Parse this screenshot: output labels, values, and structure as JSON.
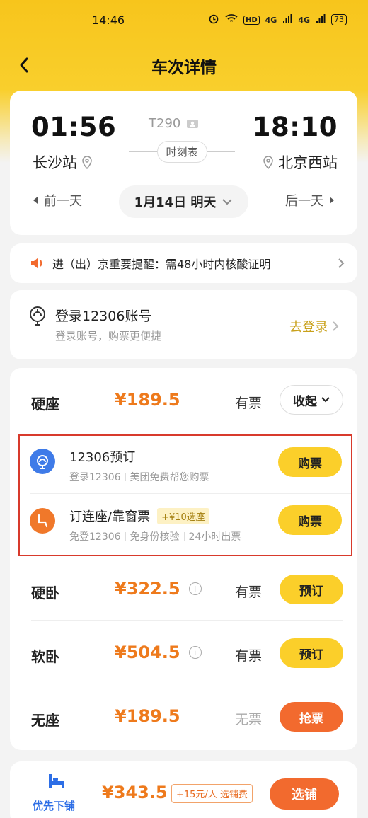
{
  "status_bar": {
    "time": "14:46",
    "signal1": "4G",
    "signal2": "4G",
    "battery": "73",
    "hd_label": "HD"
  },
  "nav": {
    "title": "车次详情"
  },
  "train": {
    "depart_time": "01:56",
    "arrive_time": "18:10",
    "depart_station": "长沙站",
    "arrive_station": "北京西站",
    "train_number": "T290",
    "timetable_label": "时刻表",
    "prev_day": "前一天",
    "next_day": "后一天",
    "date": "1月14日 明天"
  },
  "notice": {
    "text": "进（出）京重要提醒：需48小时内核酸证明"
  },
  "login": {
    "title": "登录12306账号",
    "subtitle": "登录账号，购票更便捷",
    "action": "去登录"
  },
  "seats": [
    {
      "name": "硬座",
      "price": "¥189.5",
      "availability": "有票",
      "button": "收起"
    },
    {
      "name": "硬卧",
      "price": "¥322.5",
      "availability": "有票",
      "button": "预订"
    },
    {
      "name": "软卧",
      "price": "¥504.5",
      "availability": "有票",
      "button": "预订"
    },
    {
      "name": "无座",
      "price": "¥189.5",
      "availability": "无票",
      "button": "抢票"
    }
  ],
  "options": [
    {
      "title": "12306预订",
      "sub": [
        "登录12306",
        "美团免费帮您购票"
      ],
      "button": "购票"
    },
    {
      "title": "订连座/靠窗票",
      "tag": "+¥10选座",
      "sub": [
        "免登12306",
        "免身份核验",
        "24小时出票"
      ],
      "button": "购票"
    }
  ],
  "bottom": {
    "label": "优先下铺",
    "price": "¥343.5",
    "fee": "+15元/人 选铺费",
    "button": "选铺"
  },
  "colors": {
    "brand_yellow": "#fbcf2a",
    "price_orange": "#ee7a1c",
    "action_orange": "#f26a2e",
    "highlight_red": "#d83a2c",
    "login_gold": "#c9a11b",
    "bunk_blue": "#2d6ee6"
  }
}
